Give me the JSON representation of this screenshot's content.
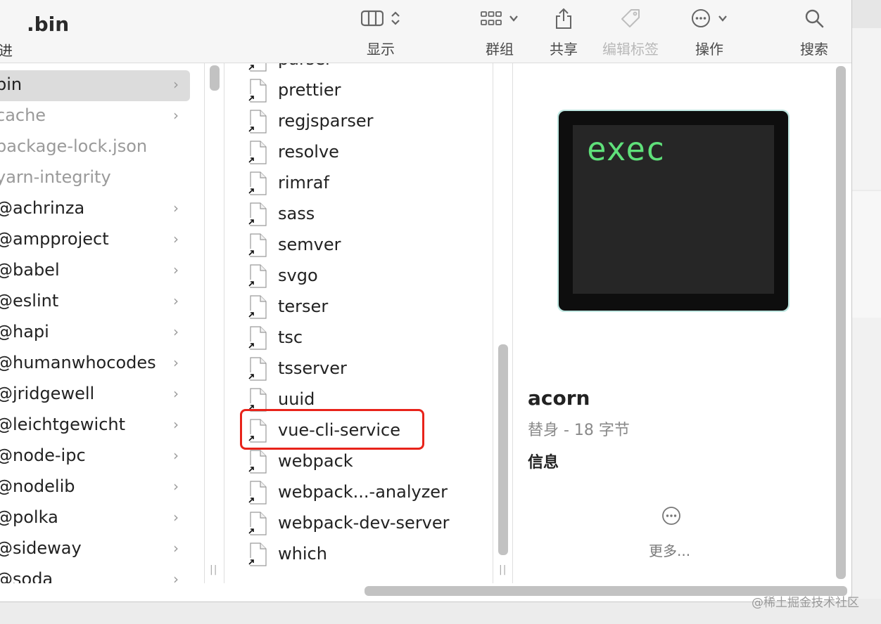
{
  "window": {
    "title": ".bin",
    "back_label": "进"
  },
  "toolbar": {
    "display": "显示",
    "group": "群组",
    "share": "共享",
    "edit_tags": "编辑标签",
    "actions": "操作",
    "search": "搜索"
  },
  "sidebar": {
    "items": [
      {
        "label": "bin",
        "chevron": true,
        "selected": true,
        "dim": false
      },
      {
        "label": "cache",
        "chevron": true,
        "selected": false,
        "dim": true
      },
      {
        "label": "package-lock.json",
        "chevron": false,
        "selected": false,
        "dim": true
      },
      {
        "label": "yarn-integrity",
        "chevron": false,
        "selected": false,
        "dim": true
      },
      {
        "label": "@achrinza",
        "chevron": true,
        "selected": false,
        "dim": false
      },
      {
        "label": "@ampproject",
        "chevron": true,
        "selected": false,
        "dim": false
      },
      {
        "label": "@babel",
        "chevron": true,
        "selected": false,
        "dim": false
      },
      {
        "label": "@eslint",
        "chevron": true,
        "selected": false,
        "dim": false
      },
      {
        "label": "@hapi",
        "chevron": true,
        "selected": false,
        "dim": false
      },
      {
        "label": "@humanwhocodes",
        "chevron": true,
        "selected": false,
        "dim": false
      },
      {
        "label": "@jridgewell",
        "chevron": true,
        "selected": false,
        "dim": false
      },
      {
        "label": "@leichtgewicht",
        "chevron": true,
        "selected": false,
        "dim": false
      },
      {
        "label": "@node-ipc",
        "chevron": true,
        "selected": false,
        "dim": false
      },
      {
        "label": "@nodelib",
        "chevron": true,
        "selected": false,
        "dim": false
      },
      {
        "label": "@polka",
        "chevron": true,
        "selected": false,
        "dim": false
      },
      {
        "label": "@sideway",
        "chevron": true,
        "selected": false,
        "dim": false
      },
      {
        "label": "@soda",
        "chevron": true,
        "selected": false,
        "dim": false
      }
    ]
  },
  "files": {
    "items": [
      "parser",
      "prettier",
      "regjsparser",
      "resolve",
      "rimraf",
      "sass",
      "semver",
      "svgo",
      "terser",
      "tsc",
      "tsserver",
      "uuid",
      "vue-cli-service",
      "webpack",
      "webpack...-analyzer",
      "webpack-dev-server",
      "which"
    ],
    "highlighted": "vue-cli-service"
  },
  "preview": {
    "terminal_text": "exec",
    "name": "acorn",
    "subtitle": "替身 - 18 字节",
    "info_heading": "信息",
    "more_label": "更多..."
  },
  "watermark": "@稀土掘金技术社区",
  "colors": {
    "highlight": "#e8231a",
    "terminal_green": "#5fe07a",
    "selection": "#dcdcdc"
  }
}
